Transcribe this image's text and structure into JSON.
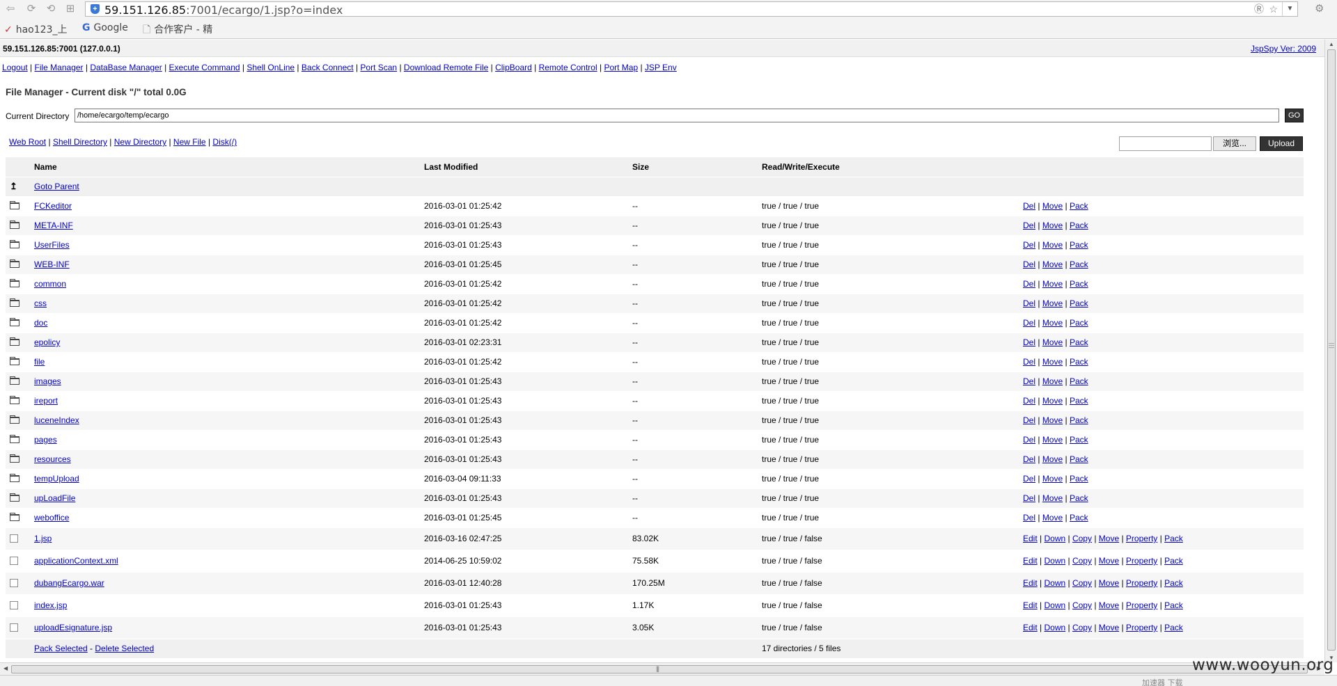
{
  "browser": {
    "url_host": "59.151.126.85",
    "url_path": ":7001/ecargo/1.jsp?o=index",
    "bookmarks": [
      {
        "icon": "✓",
        "label": "hao123_上"
      },
      {
        "icon": "G",
        "label": "Google"
      },
      {
        "icon": "🗋",
        "label": "合作客户 - 精"
      }
    ]
  },
  "header": {
    "host": "59.151.126.85:7001 (127.0.0.1)",
    "version": "JspSpy Ver: 2009"
  },
  "menu": [
    "Logout",
    "File Manager",
    "DataBase Manager",
    "Execute Command",
    "Shell OnLine",
    "Back Connect",
    "Port Scan",
    "Download Remote File",
    "ClipBoard",
    "Remote Control",
    "Port Map",
    "JSP Env"
  ],
  "file_manager": {
    "title": "File Manager - Current disk \"/\" total 0.0G",
    "current_dir_label": "Current Directory",
    "current_dir": "/home/ecargo/temp/ecargo",
    "go_label": "GO",
    "quick_links": [
      "Web Root",
      "Shell Directory",
      "New Directory",
      "New File",
      "Disk(/)"
    ],
    "browse_label": "浏览...",
    "upload_label": "Upload",
    "columns": [
      "Name",
      "Last Modified",
      "Size",
      "Read/Write/Execute"
    ],
    "goto_parent": "Goto Parent",
    "dir_actions": [
      "Del",
      "Move",
      "Pack"
    ],
    "file_actions": [
      "Edit",
      "Down",
      "Copy",
      "Move",
      "Property",
      "Pack"
    ],
    "directories": [
      {
        "name": "FCKeditor",
        "modified": "2016-03-01 01:25:42",
        "size": "--",
        "rwx": "true / true / true"
      },
      {
        "name": "META-INF",
        "modified": "2016-03-01 01:25:43",
        "size": "--",
        "rwx": "true / true / true"
      },
      {
        "name": "UserFiles",
        "modified": "2016-03-01 01:25:43",
        "size": "--",
        "rwx": "true / true / true"
      },
      {
        "name": "WEB-INF",
        "modified": "2016-03-01 01:25:45",
        "size": "--",
        "rwx": "true / true / true"
      },
      {
        "name": "common",
        "modified": "2016-03-01 01:25:42",
        "size": "--",
        "rwx": "true / true / true"
      },
      {
        "name": "css",
        "modified": "2016-03-01 01:25:42",
        "size": "--",
        "rwx": "true / true / true"
      },
      {
        "name": "doc",
        "modified": "2016-03-01 01:25:42",
        "size": "--",
        "rwx": "true / true / true"
      },
      {
        "name": "epolicy",
        "modified": "2016-03-01 02:23:31",
        "size": "--",
        "rwx": "true / true / true"
      },
      {
        "name": "file",
        "modified": "2016-03-01 01:25:42",
        "size": "--",
        "rwx": "true / true / true"
      },
      {
        "name": "images",
        "modified": "2016-03-01 01:25:43",
        "size": "--",
        "rwx": "true / true / true"
      },
      {
        "name": "ireport",
        "modified": "2016-03-01 01:25:43",
        "size": "--",
        "rwx": "true / true / true"
      },
      {
        "name": "luceneIndex",
        "modified": "2016-03-01 01:25:43",
        "size": "--",
        "rwx": "true / true / true"
      },
      {
        "name": "pages",
        "modified": "2016-03-01 01:25:43",
        "size": "--",
        "rwx": "true / true / true"
      },
      {
        "name": "resources",
        "modified": "2016-03-01 01:25:43",
        "size": "--",
        "rwx": "true / true / true"
      },
      {
        "name": "tempUpload",
        "modified": "2016-03-04 09:11:33",
        "size": "--",
        "rwx": "true / true / true"
      },
      {
        "name": "upLoadFile",
        "modified": "2016-03-01 01:25:43",
        "size": "--",
        "rwx": "true / true / true"
      },
      {
        "name": "weboffice",
        "modified": "2016-03-01 01:25:45",
        "size": "--",
        "rwx": "true / true / true"
      }
    ],
    "files": [
      {
        "name": "1.jsp",
        "modified": "2016-03-16 02:47:25",
        "size": "83.02K",
        "rwx": "true / true / false"
      },
      {
        "name": "applicationContext.xml",
        "modified": "2014-06-25 10:59:02",
        "size": "75.58K",
        "rwx": "true / true / false"
      },
      {
        "name": "dubangEcargo.war",
        "modified": "2016-03-01 12:40:28",
        "size": "170.25M",
        "rwx": "true / true / false"
      },
      {
        "name": "index.jsp",
        "modified": "2016-03-01 01:25:43",
        "size": "1.17K",
        "rwx": "true / true / false"
      },
      {
        "name": "uploadEsignature.jsp",
        "modified": "2016-03-01 01:25:43",
        "size": "3.05K",
        "rwx": "true / true / false"
      }
    ],
    "pack_selected": "Pack Selected",
    "delete_selected": "Delete Selected",
    "summary": "17 directories / 5 files"
  },
  "status": {
    "text": "加速器  下载"
  },
  "watermark": "www.wooyun.org"
}
